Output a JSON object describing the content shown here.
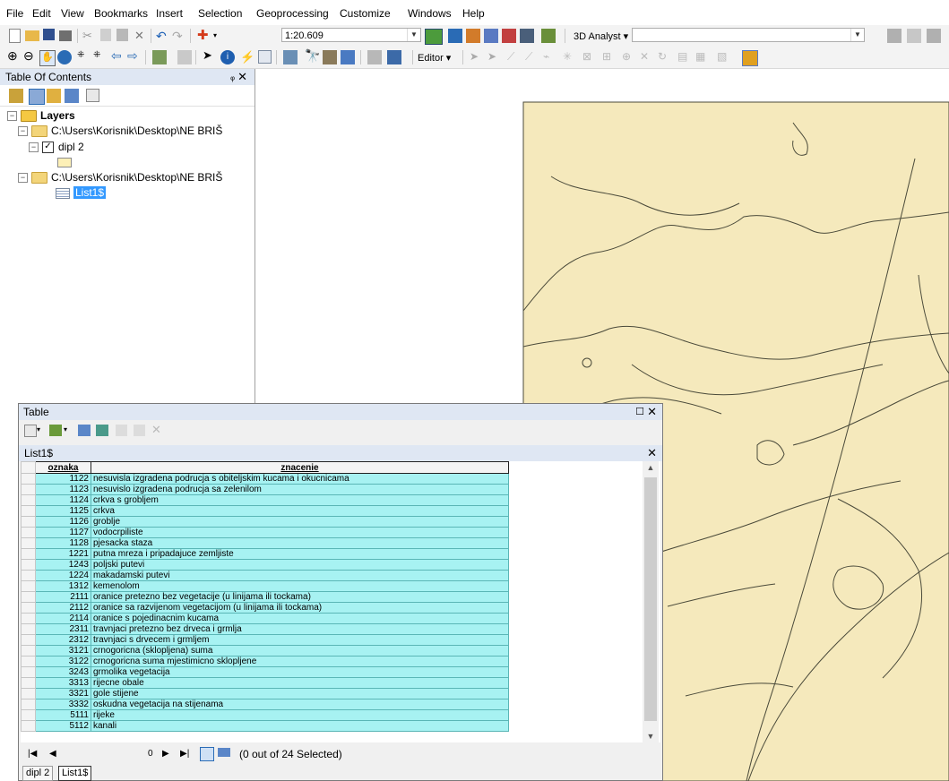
{
  "menu": [
    "File",
    "Edit",
    "View",
    "Bookmarks",
    "Insert",
    "Selection",
    "Geoprocessing",
    "Customize",
    "Windows",
    "Help"
  ],
  "toolbar": {
    "scale": "1:20.609",
    "analyst_label": "3D Analyst ▾",
    "editor_label": "Editor ▾"
  },
  "toc": {
    "title": "Table Of Contents",
    "layers_label": "Layers",
    "source1": "C:\\Users\\Korisnik\\Desktop\\NE BRIŠ",
    "layer1": "dipl 2",
    "source2": "C:\\Users\\Korisnik\\Desktop\\NE BRIŠ",
    "table1": "List1$"
  },
  "table_window": {
    "title": "Table",
    "tab_label": "List1$",
    "columns": [
      "oznaka",
      "znacenie"
    ],
    "rows": [
      [
        "1122",
        "nesuvisla izgradena podrucja s obiteljskim kucama i okucnicama"
      ],
      [
        "1123",
        "nesuvislo izgradena podrucja sa zelenilom"
      ],
      [
        "1124",
        "crkva s grobljem"
      ],
      [
        "1125",
        "crkva"
      ],
      [
        "1126",
        "groblje"
      ],
      [
        "1127",
        "vodocrpiliste"
      ],
      [
        "1128",
        "pjesacka staza"
      ],
      [
        "1221",
        "putna mreza i pripadajuce zemljiste"
      ],
      [
        "1243",
        "poljski putevi"
      ],
      [
        "1224",
        "makadamski putevi"
      ],
      [
        "1312",
        "kemenolom"
      ],
      [
        "2111",
        "oranice pretezno bez vegetacije  (u linijama ili tockama)"
      ],
      [
        "2112",
        "oranice sa razvijenom vegetacijom (u linijama ili tockama)"
      ],
      [
        "2114",
        "oranice s pojedinacnim kucama"
      ],
      [
        "2311",
        "travnjaci pretezno bez drveca i grmlja"
      ],
      [
        "2312",
        "travnjaci s drvecem i grmljem"
      ],
      [
        "3121",
        "crnogoricna (sklopljena) suma"
      ],
      [
        "3122",
        "crnogoricna suma mjestimicno sklopljene"
      ],
      [
        "3243",
        "grmolika vegetacija"
      ],
      [
        "3313",
        "rijecne obale"
      ],
      [
        "3321",
        "gole stijene"
      ],
      [
        "3332",
        "oskudna vegetacija na stijenama"
      ],
      [
        "5111",
        "rijeke"
      ],
      [
        "5112",
        "kanali"
      ]
    ],
    "record_index": "0",
    "selection_status": "(0 out of 24 Selected)",
    "bottom_tabs": [
      "dipl 2",
      "List1$"
    ]
  },
  "colors": {
    "map_fill": "#f5e9bc",
    "map_line": "#4a4a3a",
    "row_bg": "#a7f2f2",
    "panel_title": "#dfe7f3"
  }
}
